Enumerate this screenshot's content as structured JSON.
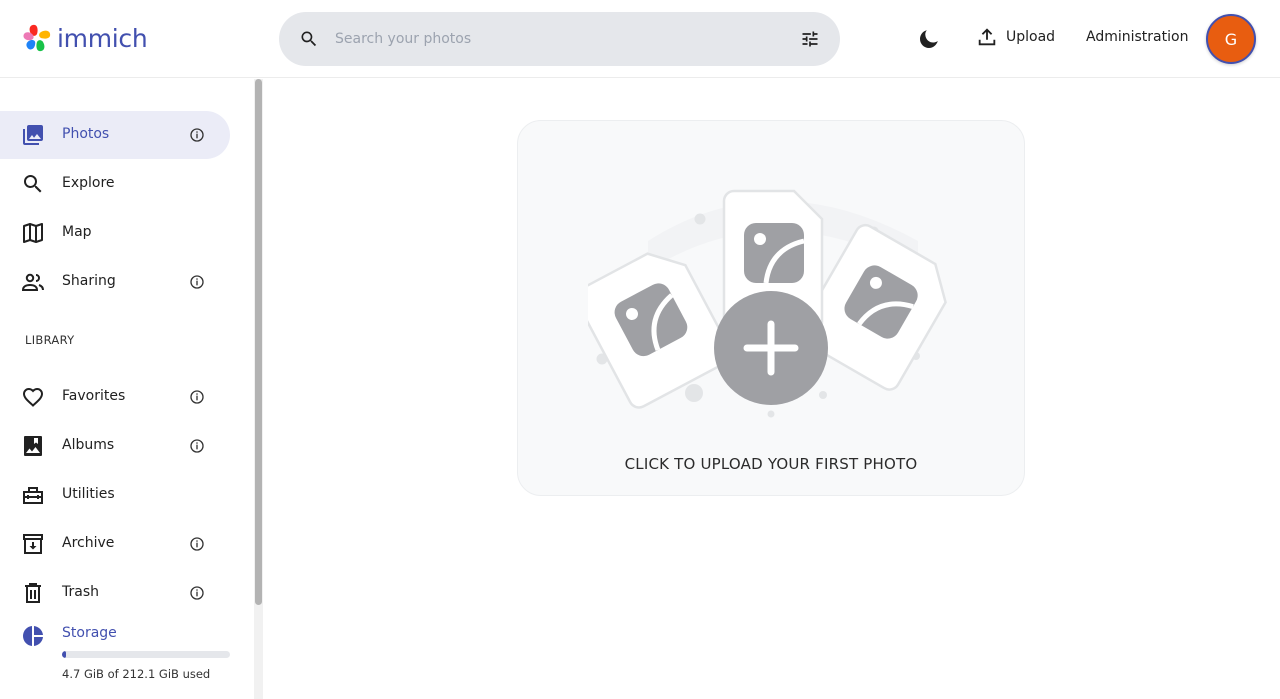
{
  "app": {
    "name": "immich",
    "brand_color": "#4250af"
  },
  "header": {
    "search": {
      "placeholder": "Search your photos",
      "value": "",
      "icon": "search-icon",
      "filter_icon": "tune-icon"
    },
    "theme_toggle_icon": "moon-icon",
    "upload_label": "Upload",
    "upload_icon": "upload-icon",
    "administration_label": "Administration",
    "avatar": {
      "initial": "G",
      "color": "#e85d10"
    }
  },
  "sidebar": {
    "items": [
      {
        "label": "Photos",
        "icon": "photos-icon",
        "active": true,
        "info": true
      },
      {
        "label": "Explore",
        "icon": "search-icon",
        "active": false,
        "info": false
      },
      {
        "label": "Map",
        "icon": "map-icon",
        "active": false,
        "info": false
      },
      {
        "label": "Sharing",
        "icon": "sharing-icon",
        "active": false,
        "info": true
      }
    ],
    "library_label": "LIBRARY",
    "library_items": [
      {
        "label": "Favorites",
        "icon": "heart-icon",
        "info": true
      },
      {
        "label": "Albums",
        "icon": "album-icon",
        "info": true
      },
      {
        "label": "Utilities",
        "icon": "toolbox-icon",
        "info": false
      },
      {
        "label": "Archive",
        "icon": "archive-icon",
        "info": true
      },
      {
        "label": "Trash",
        "icon": "trash-icon",
        "info": true
      }
    ],
    "storage": {
      "label": "Storage",
      "icon": "storage-pie-icon",
      "used": "4.7 GiB",
      "total": "212.1 GiB",
      "used_fraction": 0.022,
      "text": "4.7 GiB of 212.1 GiB used"
    }
  },
  "main": {
    "empty_state": {
      "cta": "CLICK TO UPLOAD YOUR FIRST PHOTO",
      "illustration": "upload-photos-illustration"
    }
  }
}
